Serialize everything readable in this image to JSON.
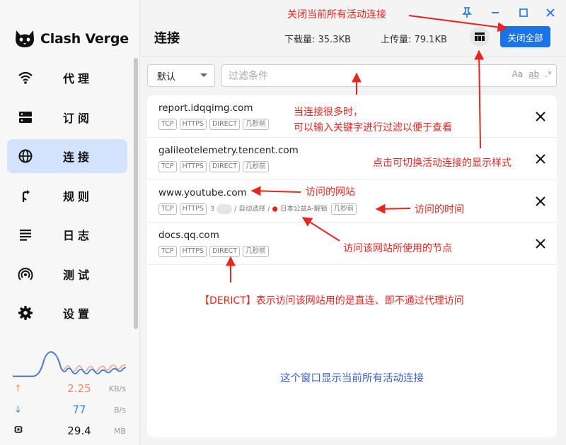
{
  "app": {
    "name": "Clash Verge"
  },
  "sidebar": {
    "items": [
      {
        "label": "代理",
        "icon": "wifi-icon",
        "active": false
      },
      {
        "label": "订阅",
        "icon": "server-icon",
        "active": false
      },
      {
        "label": "连接",
        "icon": "globe-icon",
        "active": true
      },
      {
        "label": "规则",
        "icon": "route-icon",
        "active": false
      },
      {
        "label": "日志",
        "icon": "log-icon",
        "active": false
      },
      {
        "label": "测试",
        "icon": "radar-icon",
        "active": false
      },
      {
        "label": "设置",
        "icon": "gear-icon",
        "active": false
      }
    ],
    "stats": {
      "upload": {
        "value": "2.25",
        "unit": "KB/s",
        "color": "#f08c6b"
      },
      "download": {
        "value": "77",
        "unit": "B/s",
        "color": "#3b7fd4"
      },
      "memory": {
        "value": "29.4",
        "unit": "MB"
      }
    }
  },
  "header": {
    "title": "连接",
    "download": "下载量: 35.3KB",
    "upload": "上传量: 79.1KB",
    "close_all": "关闭全部"
  },
  "filter": {
    "select_value": "默认",
    "placeholder": "过滤条件",
    "options": [
      "Aa",
      "ab",
      ".*"
    ]
  },
  "connections": [
    {
      "host": "report.idqqimg.com",
      "tags": [
        "TCP",
        "HTTPS",
        "DIRECT",
        "几秒前"
      ]
    },
    {
      "host": "galileotelemetry.tencent.com",
      "tags": [
        "TCP",
        "HTTPS",
        "DIRECT",
        "几秒前"
      ]
    },
    {
      "host": "www.youtube.com",
      "tags": [
        "TCP",
        "HTTPS",
        "3",
        "/ 自动选择 /",
        "日本公益A-解锁",
        "几秒前"
      ]
    },
    {
      "host": "docs.qq.com",
      "tags": [
        "TCP",
        "HTTPS",
        "DIRECT",
        "几秒前"
      ]
    }
  ],
  "list_note": "这个窗口显示当前所有活动连接",
  "annotations": {
    "close_all": "关闭当前所有活动连接",
    "filter_line1": "当连接很多时，",
    "filter_line2": "可以输入关键字进行过滤以便于查看",
    "layout": "点击可切换活动连接的显示样式",
    "site": "访问的网站",
    "time": "访问的时间",
    "node": "访问该网站所使用的节点",
    "direct": "【DERICT】表示访问该网站用的是直连、即不通过代理访问"
  },
  "colors": {
    "accent": "#1a73e8",
    "annotation": "#e8251f",
    "active_nav": "#d3e3fd"
  }
}
